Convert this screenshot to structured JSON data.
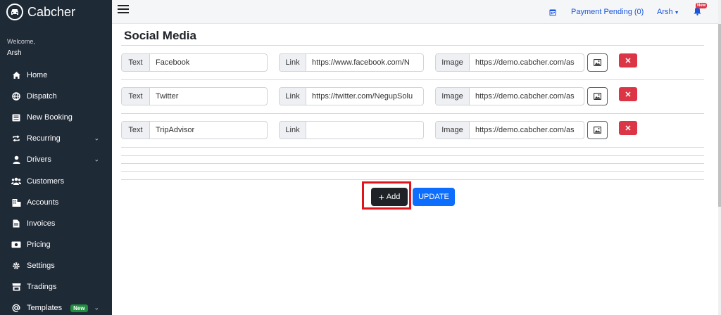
{
  "app": {
    "brand": "Cabcher",
    "welcome": "Welcome,",
    "user": "Arsh"
  },
  "sidebar": {
    "items": [
      {
        "label": "Home",
        "icon": "home-icon"
      },
      {
        "label": "Dispatch",
        "icon": "globe-icon"
      },
      {
        "label": "New Booking",
        "icon": "list-icon"
      },
      {
        "label": "Recurring",
        "icon": "repeat-icon",
        "chevron": true
      },
      {
        "label": "Drivers",
        "icon": "user-icon",
        "chevron": true
      },
      {
        "label": "Customers",
        "icon": "users-icon"
      },
      {
        "label": "Accounts",
        "icon": "building-icon"
      },
      {
        "label": "Invoices",
        "icon": "file-icon"
      },
      {
        "label": "Pricing",
        "icon": "money-icon"
      },
      {
        "label": "Settings",
        "icon": "gear-icon"
      },
      {
        "label": "Tradings",
        "icon": "store-icon"
      },
      {
        "label": "Templates",
        "icon": "at-icon",
        "badge": "New",
        "chevron": true
      }
    ]
  },
  "topbar": {
    "payment": "Payment Pending (0)",
    "user_menu": "Arsh",
    "bell_badge": "New"
  },
  "main": {
    "title": "Social Media",
    "text_label": "Text",
    "link_label": "Link",
    "image_label": "Image",
    "rows": [
      {
        "text": "Facebook",
        "link": "https://www.facebook.com/N",
        "image": "https://demo.cabcher.com/as"
      },
      {
        "text": "Twitter",
        "link": "https://twitter.com/NegupSolu",
        "image": "https://demo.cabcher.com/as"
      },
      {
        "text": "TripAdvisor",
        "link": "",
        "image": "https://demo.cabcher.com/as"
      }
    ],
    "add_label": "Add",
    "update_label": "UPDATE"
  },
  "colors": {
    "sidebar_bg": "#1f2a37",
    "accent": "#0d6efd",
    "danger": "#dc3545",
    "highlight": "#e0151b"
  }
}
